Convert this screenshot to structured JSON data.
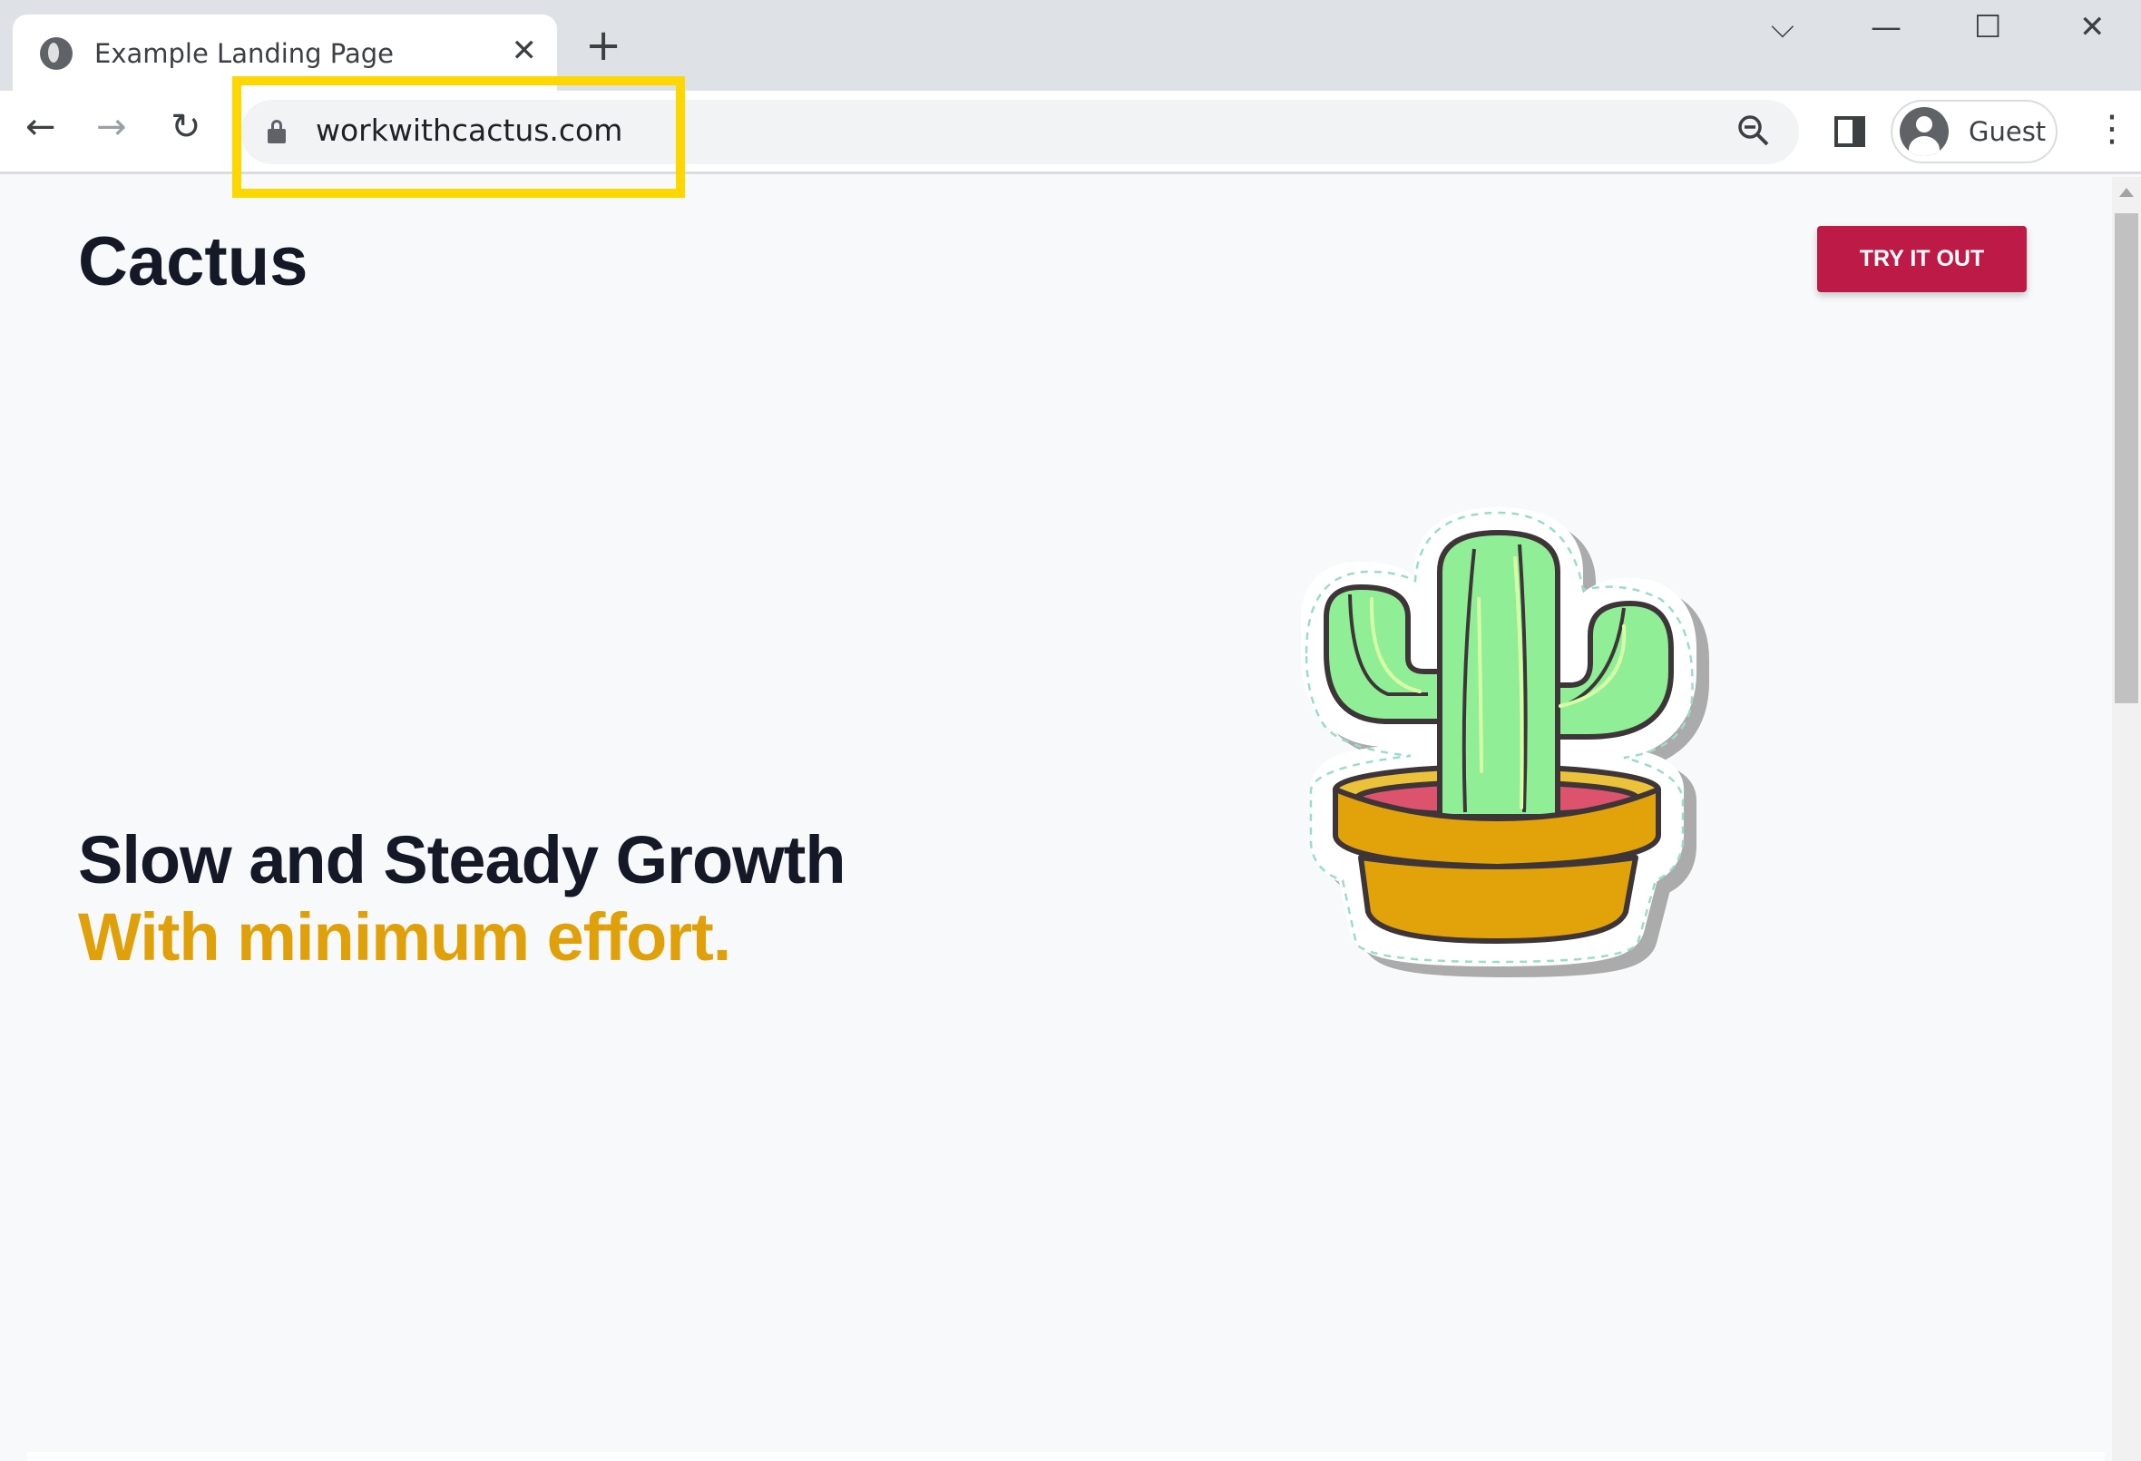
{
  "browser": {
    "tab_title": "Example Landing Page",
    "tab_close": "✕",
    "new_tab": "+",
    "controls": {
      "tab_search": "⌵",
      "minimize": "—",
      "maximize": "☐",
      "close": "✕"
    },
    "nav": {
      "back": "←",
      "forward": "→",
      "reload": "↻"
    },
    "url": "workwithcactus.com",
    "profile_label": "Guest",
    "menu": "⋮",
    "highlight_color": "#ffd700"
  },
  "page": {
    "brand": "Cactus",
    "cta_label": "TRY IT OUT",
    "headline": "Slow and Steady Growth",
    "subheadline": "With minimum effort.",
    "colors": {
      "cta": "#be1a47",
      "accent": "#e0a00a",
      "text": "#141827"
    }
  }
}
